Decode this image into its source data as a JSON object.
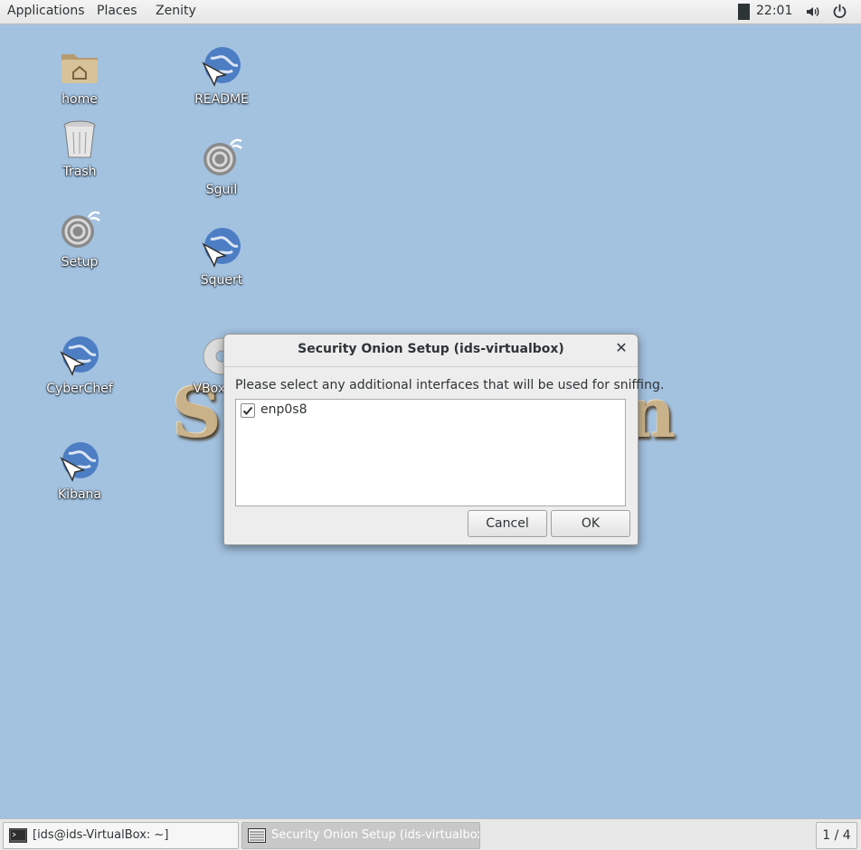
{
  "topbar": {
    "menus": [
      "Applications",
      "Places",
      "Zenity"
    ],
    "clock": "22:01",
    "icons": [
      "volume-icon",
      "power-icon"
    ]
  },
  "desktop": {
    "icons": [
      {
        "label": "home",
        "icon": "home-folder-icon"
      },
      {
        "label": "README",
        "icon": "web-link-icon"
      },
      {
        "label": "Trash",
        "icon": "trash-icon"
      },
      {
        "label": "Sguil",
        "icon": "onion-icon"
      },
      {
        "label": "Setup",
        "icon": "onion-icon"
      },
      {
        "label": "Squert",
        "icon": "web-link-icon"
      },
      {
        "label": "CyberChef",
        "icon": "web-link-icon"
      },
      {
        "label": "VBox_GA",
        "icon": "disc-icon"
      },
      {
        "label": "Kibana",
        "icon": "web-link-icon"
      }
    ],
    "background_text_left": "Se",
    "background_text_right": "n"
  },
  "dialog": {
    "title": "Security Onion Setup (ids-virtualbox)",
    "message": "Please select any additional interfaces that will be used for sniffing.",
    "interfaces": [
      {
        "name": "enp0s8",
        "checked": true
      }
    ],
    "cancel_label": "Cancel",
    "ok_label": "OK"
  },
  "taskbar": {
    "tasks": [
      {
        "label": "[ids@ids-VirtualBox: ~]",
        "icon": "terminal-icon"
      },
      {
        "label": "Security Onion Setup (ids-virtualbox)",
        "icon": "list-dialog-icon"
      }
    ],
    "workspace": "1 / 4"
  },
  "colors": {
    "desktop_bg": "#a3c2e0",
    "panel_bg": "#e8e8e8",
    "dialog_bg": "#ededed"
  }
}
